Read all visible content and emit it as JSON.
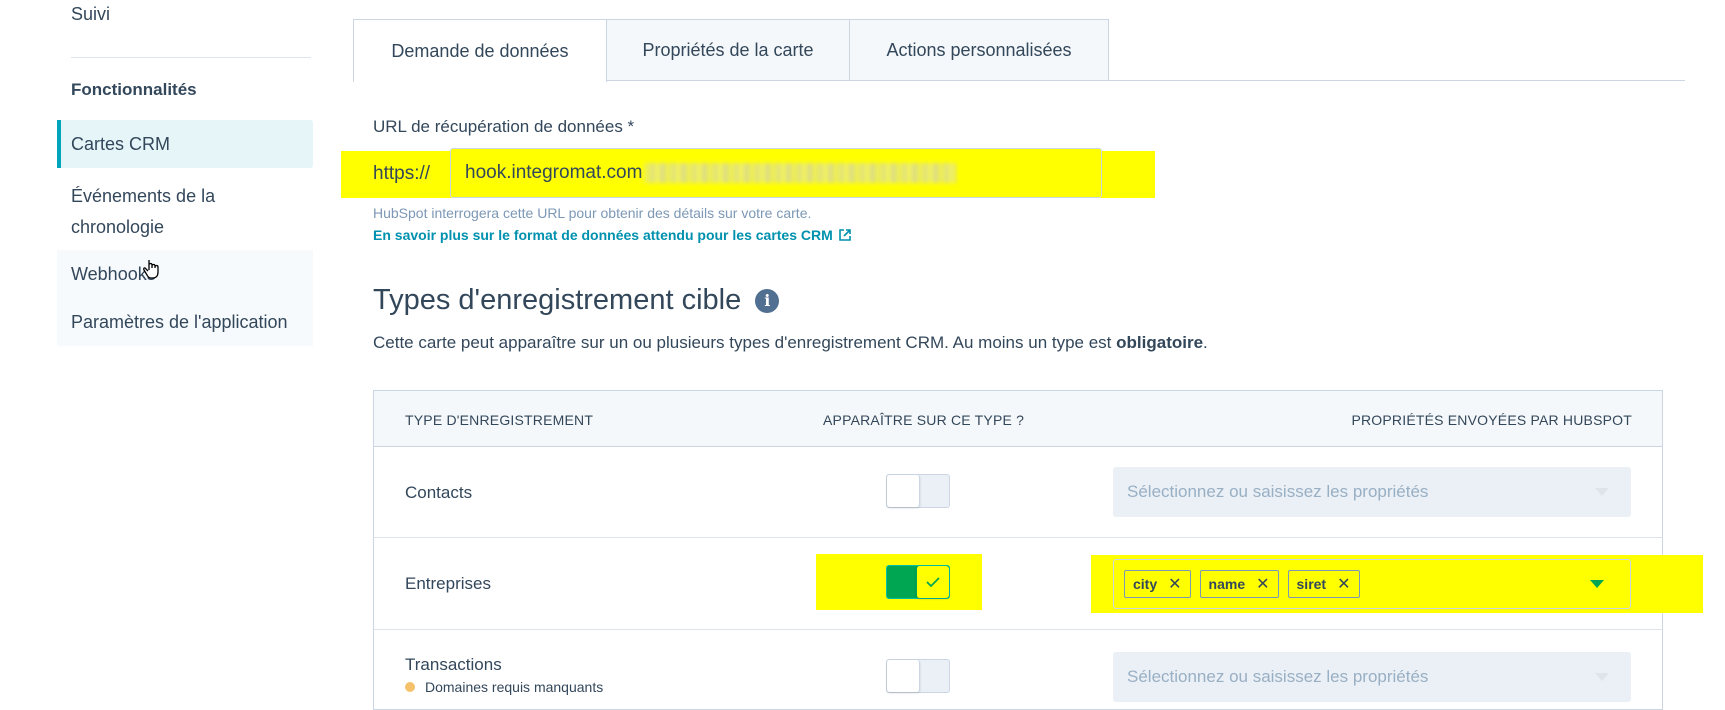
{
  "sidebar": {
    "top_link": "Suivi",
    "section_heading": "Fonctionnalités",
    "items": [
      {
        "label": "Cartes CRM",
        "active": true
      },
      {
        "label": "Événements de la"
      },
      {
        "label": "chronologie"
      },
      {
        "label": "Webhooks"
      },
      {
        "label": "Paramètres de l'application"
      }
    ]
  },
  "tabs": [
    {
      "label": "Demande de données",
      "active": true
    },
    {
      "label": "Propriétés de la carte"
    },
    {
      "label": "Actions personnalisées"
    }
  ],
  "url_field": {
    "label": "URL de récupération de données *",
    "prefix": "https://",
    "value": "hook.integromat.com",
    "help_text": "HubSpot interrogera cette URL pour obtenir des détails sur votre carte.",
    "help_link": "En savoir plus sur le format de données attendu pour les cartes CRM"
  },
  "target_types": {
    "title": "Types d'enregistrement cible",
    "description_prefix": "Cette carte peut apparaître sur un ou plusieurs types d'enregistrement CRM. Au moins un type est ",
    "description_bold": "obligatoire",
    "description_suffix": ".",
    "columns": [
      "TYPE D'ENREGISTREMENT",
      "APPARAÎTRE SUR CE TYPE ?",
      "PROPRIÉTÉS ENVOYÉES PAR HUBSPOT"
    ],
    "rows": [
      {
        "name": "Contacts",
        "enabled": false,
        "placeholder": "Sélectionnez ou saisissez les propriétés"
      },
      {
        "name": "Entreprises",
        "enabled": true,
        "chips": [
          "city",
          "name",
          "siret"
        ]
      },
      {
        "name": "Transactions",
        "enabled": false,
        "placeholder": "Sélectionnez ou saisissez les propriétés",
        "warning": "Domaines requis manquants"
      }
    ]
  },
  "colors": {
    "highlight": "#ffff00",
    "accent": "#00a4bd",
    "toggle_on": "#00a651",
    "link": "#0091ae",
    "warning_dot": "#f5c26b"
  }
}
